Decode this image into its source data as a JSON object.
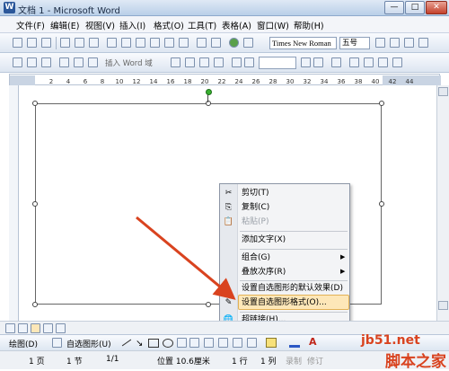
{
  "window": {
    "title": "文档 1 - Microsoft Word",
    "app_icon": "W",
    "minimize": "—",
    "maximize": "□",
    "close": "✕"
  },
  "menu": [
    "文件(F)",
    "编辑(E)",
    "视图(V)",
    "插入(I)",
    "格式(O)",
    "工具(T)",
    "表格(A)",
    "窗口(W)",
    "帮助(H)"
  ],
  "toolbar": {
    "font_name": "Times New Roman",
    "font_size": "五号",
    "insert_word_field": "插入 Word 域"
  },
  "ruler_ticks": [
    "2",
    "4",
    "6",
    "8",
    "10",
    "12",
    "14",
    "16",
    "18",
    "20",
    "22",
    "24",
    "26",
    "28",
    "30",
    "32",
    "34",
    "36",
    "38",
    "40",
    "42",
    "44"
  ],
  "context_menu": {
    "items": [
      {
        "label": "剪切(T)",
        "icon": "scissors-icon",
        "glyph": "✂",
        "disabled": false
      },
      {
        "label": "复制(C)",
        "icon": "copy-icon",
        "glyph": "⎘",
        "disabled": false
      },
      {
        "label": "粘贴(P)",
        "icon": "paste-icon",
        "glyph": "📋",
        "disabled": true
      },
      {
        "label": "添加文字(X)",
        "icon": "",
        "glyph": "",
        "disabled": false
      },
      {
        "label": "组合(G)",
        "icon": "",
        "glyph": "",
        "disabled": false,
        "submenu": true
      },
      {
        "label": "叠放次序(R)",
        "icon": "",
        "glyph": "",
        "disabled": false,
        "submenu": true
      },
      {
        "label": "设置自选图形的默认效果(D)",
        "icon": "",
        "glyph": "",
        "disabled": false
      },
      {
        "label": "设置自选图形格式(O)...",
        "icon": "format-shape-icon",
        "glyph": "✎",
        "disabled": false,
        "highlighted": true
      },
      {
        "label": "超链接(H)...",
        "icon": "hyperlink-icon",
        "glyph": "🌐",
        "disabled": false
      }
    ]
  },
  "drawbar": {
    "draw_label": "绘图(D)",
    "autoshapes_label": "自选图形(U)"
  },
  "status": {
    "page": "1 页",
    "section": "1 节",
    "page_of": "1/1",
    "position": "位置 10.6厘米",
    "line": "1 行",
    "column": "1 列",
    "record": "录制",
    "revise": "修订"
  },
  "watermark": {
    "line1": "jb51.net",
    "line2": "脚本之家"
  },
  "colors": {
    "accent": "#d9431f",
    "menu_highlight": "#fde7b8"
  }
}
